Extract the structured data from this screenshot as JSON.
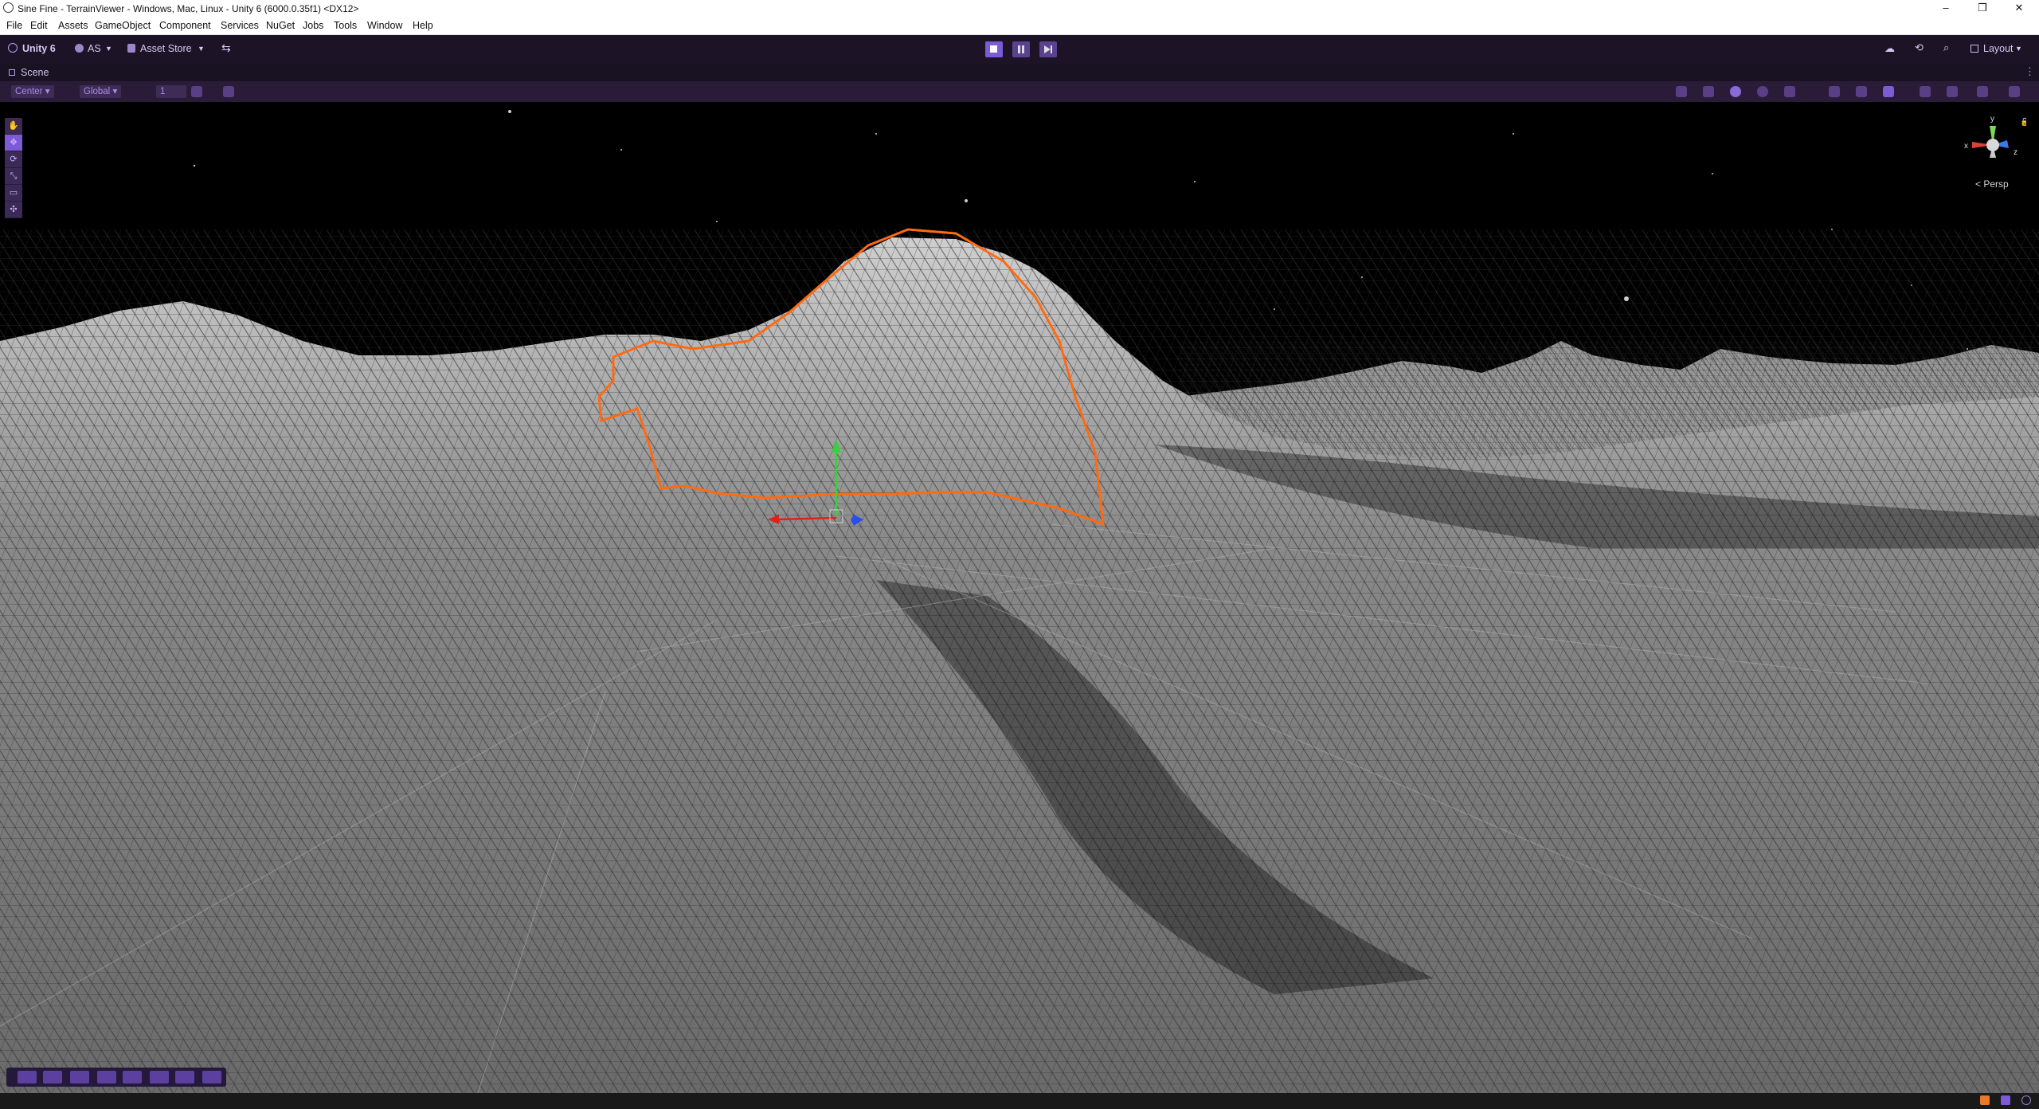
{
  "window": {
    "title": "Sine Fine - TerrainViewer - Windows, Mac, Linux - Unity 6 (6000.0.35f1) <DX12>",
    "controls": [
      "–",
      "❐",
      "✕"
    ]
  },
  "menu": [
    "File",
    "Edit",
    "Assets",
    "GameObject",
    "Component",
    "Services",
    "NuGet",
    "Jobs",
    "Tools",
    "Window",
    "Help"
  ],
  "toolbar": {
    "unity_label": "Unity 6",
    "account_label": "AS",
    "asset_store_label": "Asset Store",
    "layout_label": "Layout",
    "accent": "#7d5ad6"
  },
  "scene_tab": {
    "label": "Scene"
  },
  "overlay": {
    "pivot_mode": "Center",
    "pivot_rotation": "Global",
    "grid_snap_value": "1"
  },
  "scene_view": {
    "projection_label": "< Persp",
    "axis_labels": {
      "x": "x",
      "y": "y",
      "z": "z"
    },
    "selection_outline_color": "#ff6a10",
    "sky_color": "#000000",
    "terrain_color": "#5a5a5a"
  },
  "tools_panel": [
    "hand-tool",
    "move-tool",
    "rotate-tool",
    "scale-tool",
    "rect-tool",
    "transform-tool"
  ]
}
